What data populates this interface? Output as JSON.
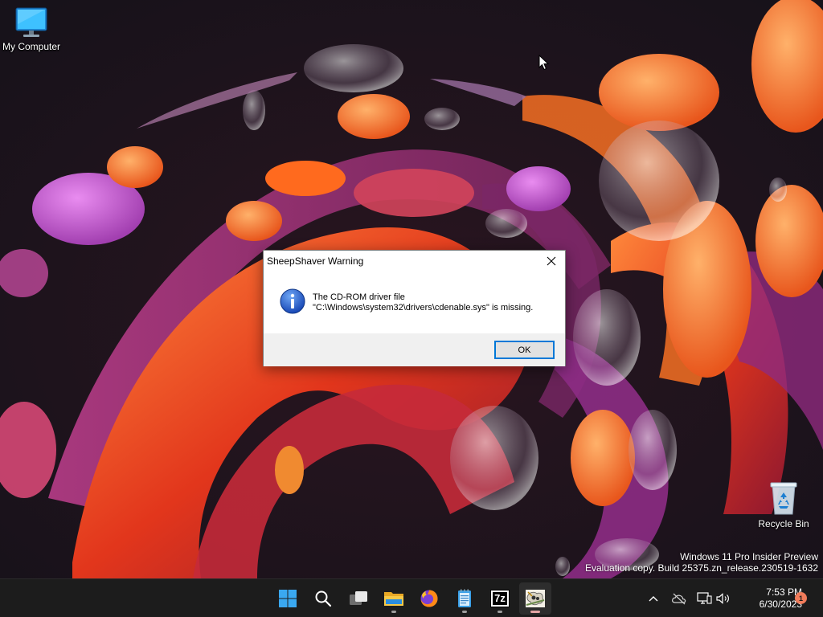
{
  "desktop": {
    "icons": [
      {
        "label": "My Computer",
        "icon": "monitor-icon"
      },
      {
        "label": "Recycle Bin",
        "icon": "recycle-bin-icon"
      }
    ],
    "watermark": {
      "line1": "Windows 11 Pro Insider Preview",
      "line2": "Evaluation copy. Build 25375.zn_release.230519-1632"
    }
  },
  "dialog": {
    "title": "SheepShaver Warning",
    "message_line1": "The CD-ROM driver file",
    "message_line2": "\"C:\\Windows\\system32\\drivers\\cdenable.sys\" is missing.",
    "ok_label": "OK",
    "icon": "info-icon"
  },
  "taskbar": {
    "apps": [
      {
        "name": "start",
        "icon": "windows-start-icon"
      },
      {
        "name": "search",
        "icon": "search-icon"
      },
      {
        "name": "task-view",
        "icon": "task-view-icon"
      },
      {
        "name": "file-explorer",
        "icon": "folder-icon"
      },
      {
        "name": "firefox",
        "icon": "firefox-icon"
      },
      {
        "name": "notepad",
        "icon": "notepad-icon"
      },
      {
        "name": "7zip",
        "icon": "7zip-icon"
      },
      {
        "name": "sheepshaver",
        "icon": "sheepshaver-icon"
      }
    ],
    "seven_zip_label": "7z",
    "tray": {
      "time": "7:53 PM",
      "date": "6/30/2023",
      "notification_count": "1"
    }
  },
  "colors": {
    "accent": "#0078d7",
    "taskbar_bg": "#1c1c1c",
    "notification_badge": "#f07c5b"
  }
}
